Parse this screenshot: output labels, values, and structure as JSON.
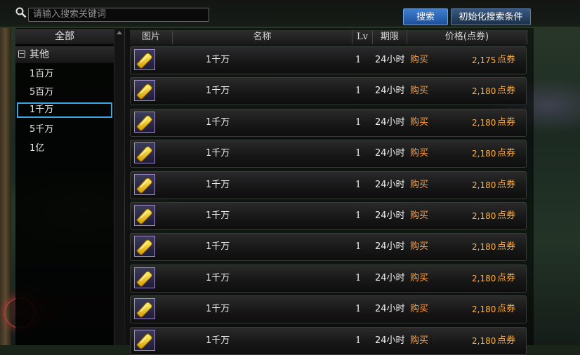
{
  "search": {
    "placeholder": "请输入搜索关键词"
  },
  "buttons": {
    "search_label": "搜索",
    "reset_label": "初始化搜索条件"
  },
  "categories": {
    "all_label": "全部",
    "group_label": "其他",
    "items": [
      {
        "label": "1百万",
        "selected": false
      },
      {
        "label": "5百万",
        "selected": false
      },
      {
        "label": "1千万",
        "selected": true
      },
      {
        "label": "5千万",
        "selected": false
      },
      {
        "label": "1亿",
        "selected": false
      }
    ]
  },
  "table": {
    "headers": {
      "image": "图片",
      "name": "名称",
      "level": "Lv",
      "period": "期限",
      "price": "价格(点券)"
    },
    "rows": [
      {
        "name": "1千万",
        "level": "1",
        "period": "24小时",
        "action": "购买",
        "price": "2,175",
        "unit": "点券"
      },
      {
        "name": "1千万",
        "level": "1",
        "period": "24小时",
        "action": "购买",
        "price": "2,180",
        "unit": "点券"
      },
      {
        "name": "1千万",
        "level": "1",
        "period": "24小时",
        "action": "购买",
        "price": "2,180",
        "unit": "点券"
      },
      {
        "name": "1千万",
        "level": "1",
        "period": "24小时",
        "action": "购买",
        "price": "2,180",
        "unit": "点券"
      },
      {
        "name": "1千万",
        "level": "1",
        "period": "24小时",
        "action": "购买",
        "price": "2,180",
        "unit": "点券"
      },
      {
        "name": "1千万",
        "level": "1",
        "period": "24小时",
        "action": "购买",
        "price": "2,180",
        "unit": "点券"
      },
      {
        "name": "1千万",
        "level": "1",
        "period": "24小时",
        "action": "购买",
        "price": "2,180",
        "unit": "点券"
      },
      {
        "name": "1千万",
        "level": "1",
        "period": "24小时",
        "action": "购买",
        "price": "2,180",
        "unit": "点券"
      },
      {
        "name": "1千万",
        "level": "1",
        "period": "24小时",
        "action": "购买",
        "price": "2,180",
        "unit": "点券"
      },
      {
        "name": "1千万",
        "level": "1",
        "period": "24小时",
        "action": "购买",
        "price": "2,180",
        "unit": "点券"
      }
    ]
  },
  "icons": {
    "search": "search-icon",
    "item": "gold-bar-icon",
    "group_toggle": "collapse-icon"
  },
  "colors": {
    "accent_blue": "#2a6bc0",
    "price_orange": "#ffb040",
    "buy_orange": "#ff9d3a",
    "selected_border": "#3ba6e0"
  }
}
